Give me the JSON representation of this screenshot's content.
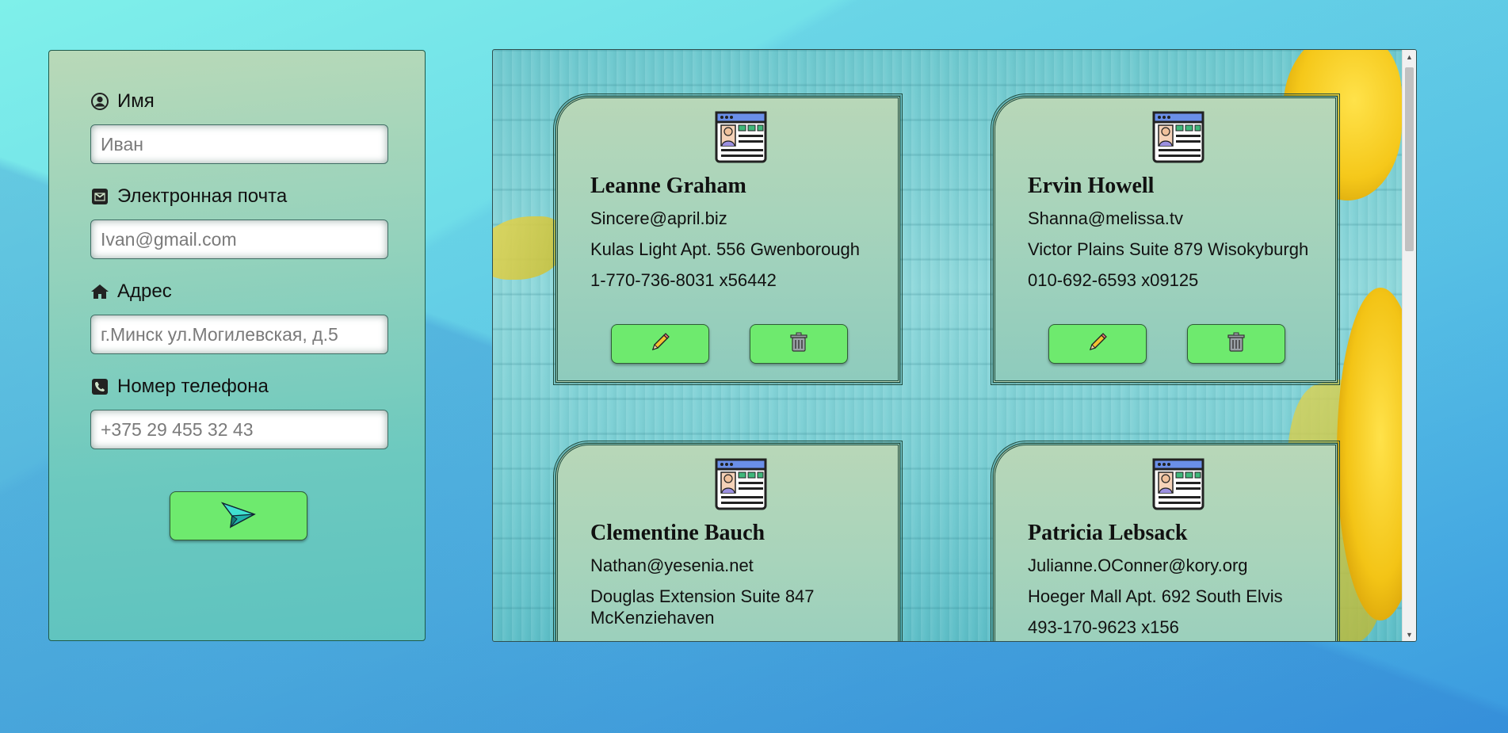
{
  "form": {
    "name": {
      "label": "Имя",
      "placeholder": "Иван",
      "icon": "user-circle-icon"
    },
    "email": {
      "label": "Электронная почта",
      "placeholder": "Ivan@gmail.com",
      "icon": "envelope-icon"
    },
    "address": {
      "label": "Адрес",
      "placeholder": "г.Минск ул.Могилевская, д.5",
      "icon": "home-icon"
    },
    "phone": {
      "label": "Номер телефона",
      "placeholder": "+375 29 455 32 43",
      "icon": "phone-icon"
    },
    "submit_icon": "paper-plane-icon"
  },
  "cards": [
    {
      "name": "Leanne Graham",
      "email": "Sincere@april.biz",
      "address": "Kulas Light Apt. 556 Gwenborough",
      "phone": "1-770-736-8031 x56442"
    },
    {
      "name": "Ervin Howell",
      "email": "Shanna@melissa.tv",
      "address": "Victor Plains Suite 879 Wisokyburgh",
      "phone": "010-692-6593 x09125"
    },
    {
      "name": "Clementine Bauch",
      "email": "Nathan@yesenia.net",
      "address": "Douglas Extension Suite 847 McKenziehaven",
      "phone": ""
    },
    {
      "name": "Patricia Lebsack",
      "email": "Julianne.OConner@kory.org",
      "address": "Hoeger Mall Apt. 692 South Elvis",
      "phone": "493-170-9623 x156"
    }
  ],
  "card_actions": {
    "edit_icon": "pencil-icon",
    "delete_icon": "trash-icon"
  },
  "colors": {
    "button_green": "#6eea6e",
    "card_border": "#1f4a3c"
  }
}
